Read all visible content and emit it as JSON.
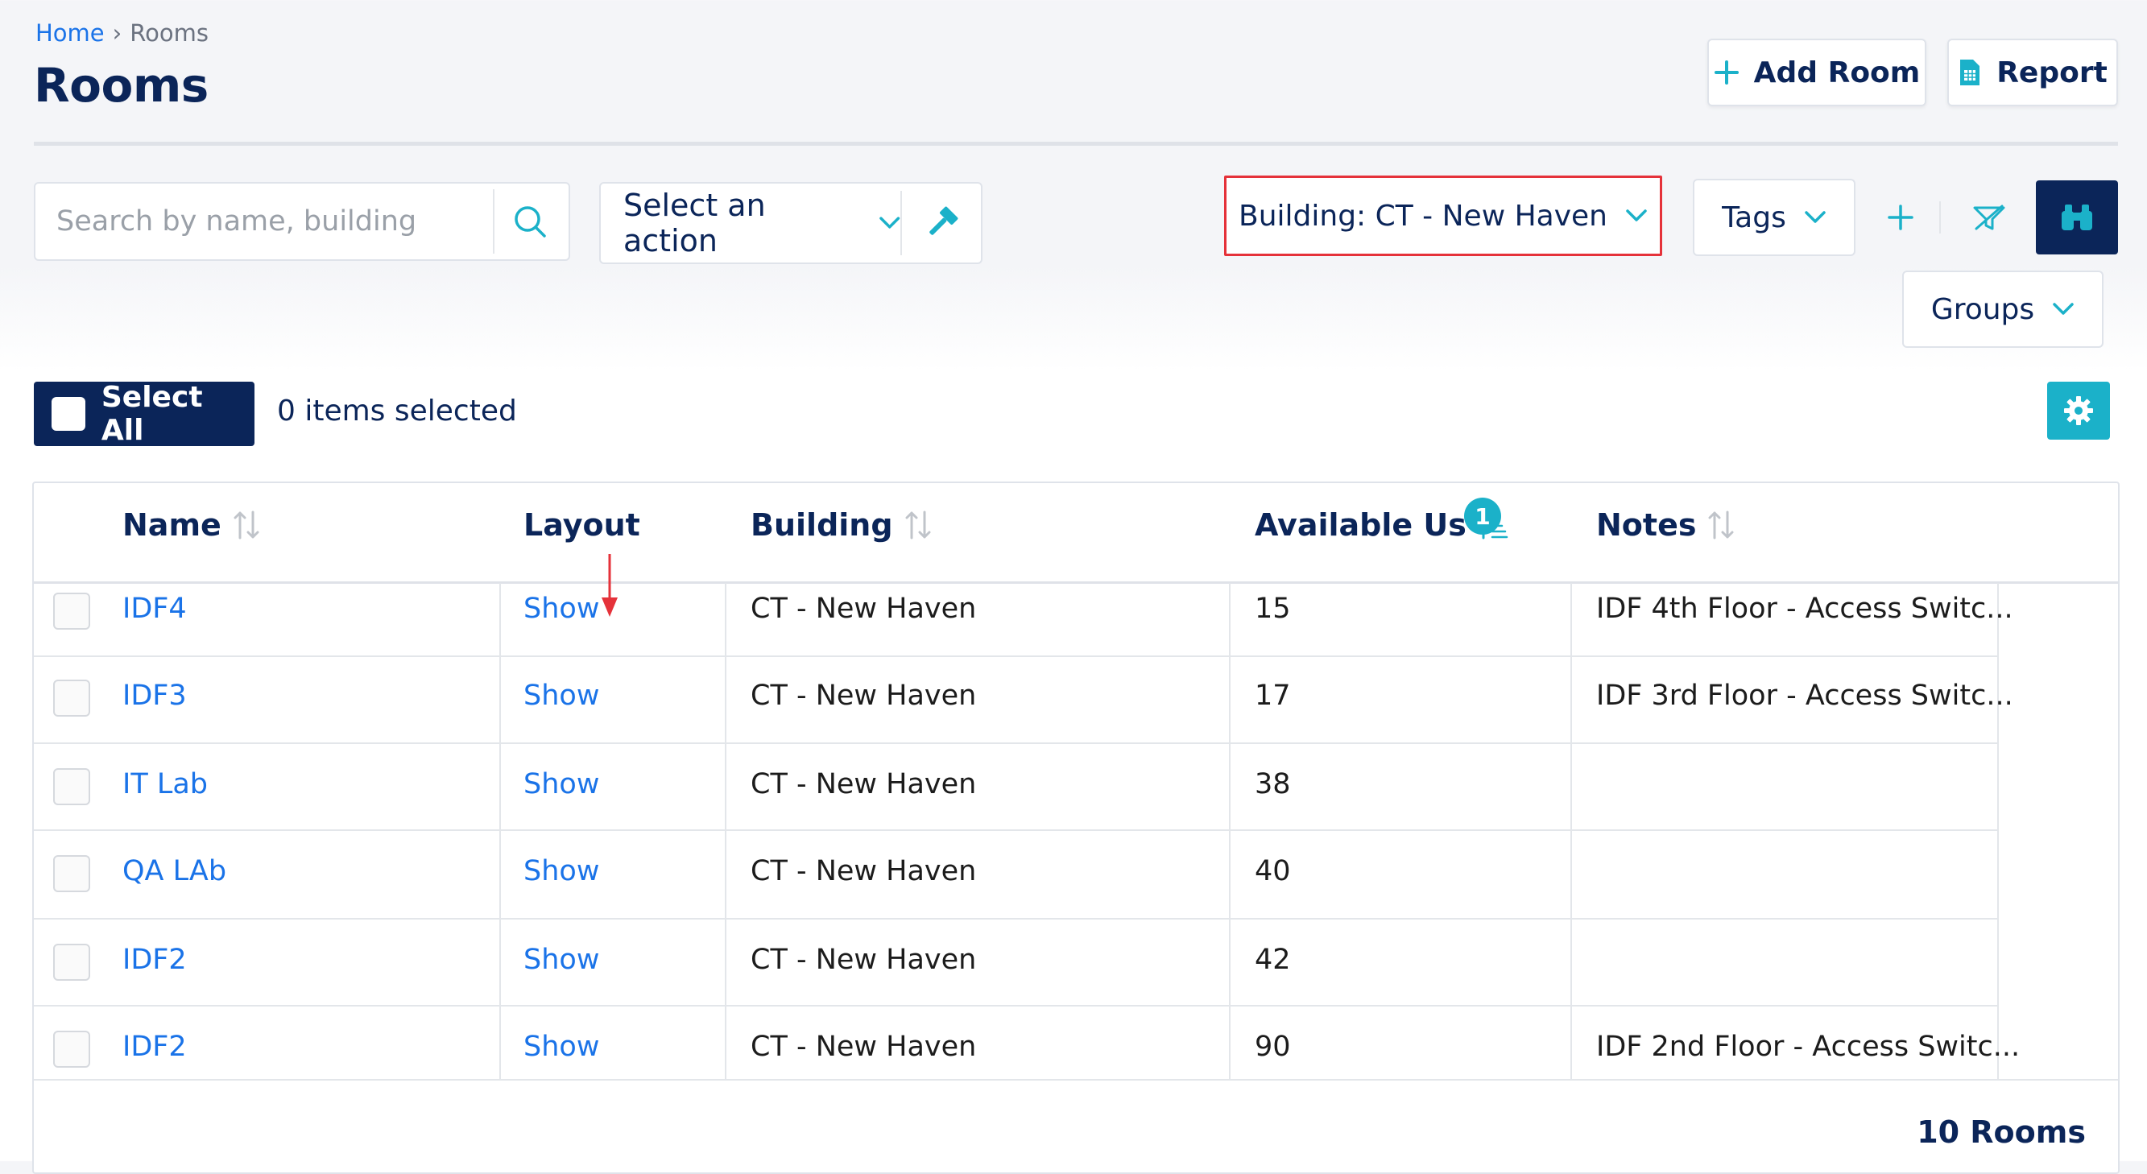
{
  "breadcrumb": {
    "home": "Home",
    "separator": "›",
    "current": "Rooms"
  },
  "page_title": "Rooms",
  "toolbar": {
    "add_room_label": "Add Room",
    "report_label": "Report"
  },
  "search": {
    "placeholder": "Search by name, building"
  },
  "action_select": {
    "label": "Select an action"
  },
  "filters": {
    "building_label": "Building: CT - New Haven",
    "tags_label": "Tags",
    "groups_label": "Groups"
  },
  "selection": {
    "select_all_label": "Select All",
    "items_selected": "0 items selected"
  },
  "table": {
    "columns": [
      {
        "label": "Name"
      },
      {
        "label": "Layout"
      },
      {
        "label": "Building"
      },
      {
        "label": "Available Us",
        "sort_badge": "1"
      },
      {
        "label": "Notes"
      }
    ],
    "rows": [
      {
        "name": "IDF4",
        "layout": "Show",
        "building": "CT - New Haven",
        "available_us": "15",
        "notes": "IDF 4th Floor - Access Switc..."
      },
      {
        "name": "IDF3",
        "layout": "Show",
        "building": "CT - New Haven",
        "available_us": "17",
        "notes": "IDF 3rd Floor - Access Switc..."
      },
      {
        "name": "IT Lab",
        "layout": "Show",
        "building": "CT - New Haven",
        "available_us": "38",
        "notes": ""
      },
      {
        "name": "QA LAb",
        "layout": "Show",
        "building": "CT - New Haven",
        "available_us": "40",
        "notes": ""
      },
      {
        "name": "IDF2",
        "layout": "Show",
        "building": "CT - New Haven",
        "available_us": "42",
        "notes": ""
      },
      {
        "name": "IDF2",
        "layout": "Show",
        "building": "CT - New Haven",
        "available_us": "90",
        "notes": "IDF 2nd Floor - Access Switc..."
      }
    ],
    "footer_count": "10 Rooms"
  },
  "icons": {
    "search": "search-icon",
    "plus": "plus-icon",
    "report": "spreadsheet-icon",
    "hammer": "hammer-icon",
    "chevron": "chevron-down-icon",
    "clear_filter": "clear-filter-icon",
    "binoculars": "binoculars-icon",
    "gear": "gear-icon",
    "sort": "sort-icon"
  },
  "colors": {
    "navy": "#0b2559",
    "teal": "#1bb1c9",
    "link": "#1a73e8",
    "highlight": "#e5323a"
  }
}
